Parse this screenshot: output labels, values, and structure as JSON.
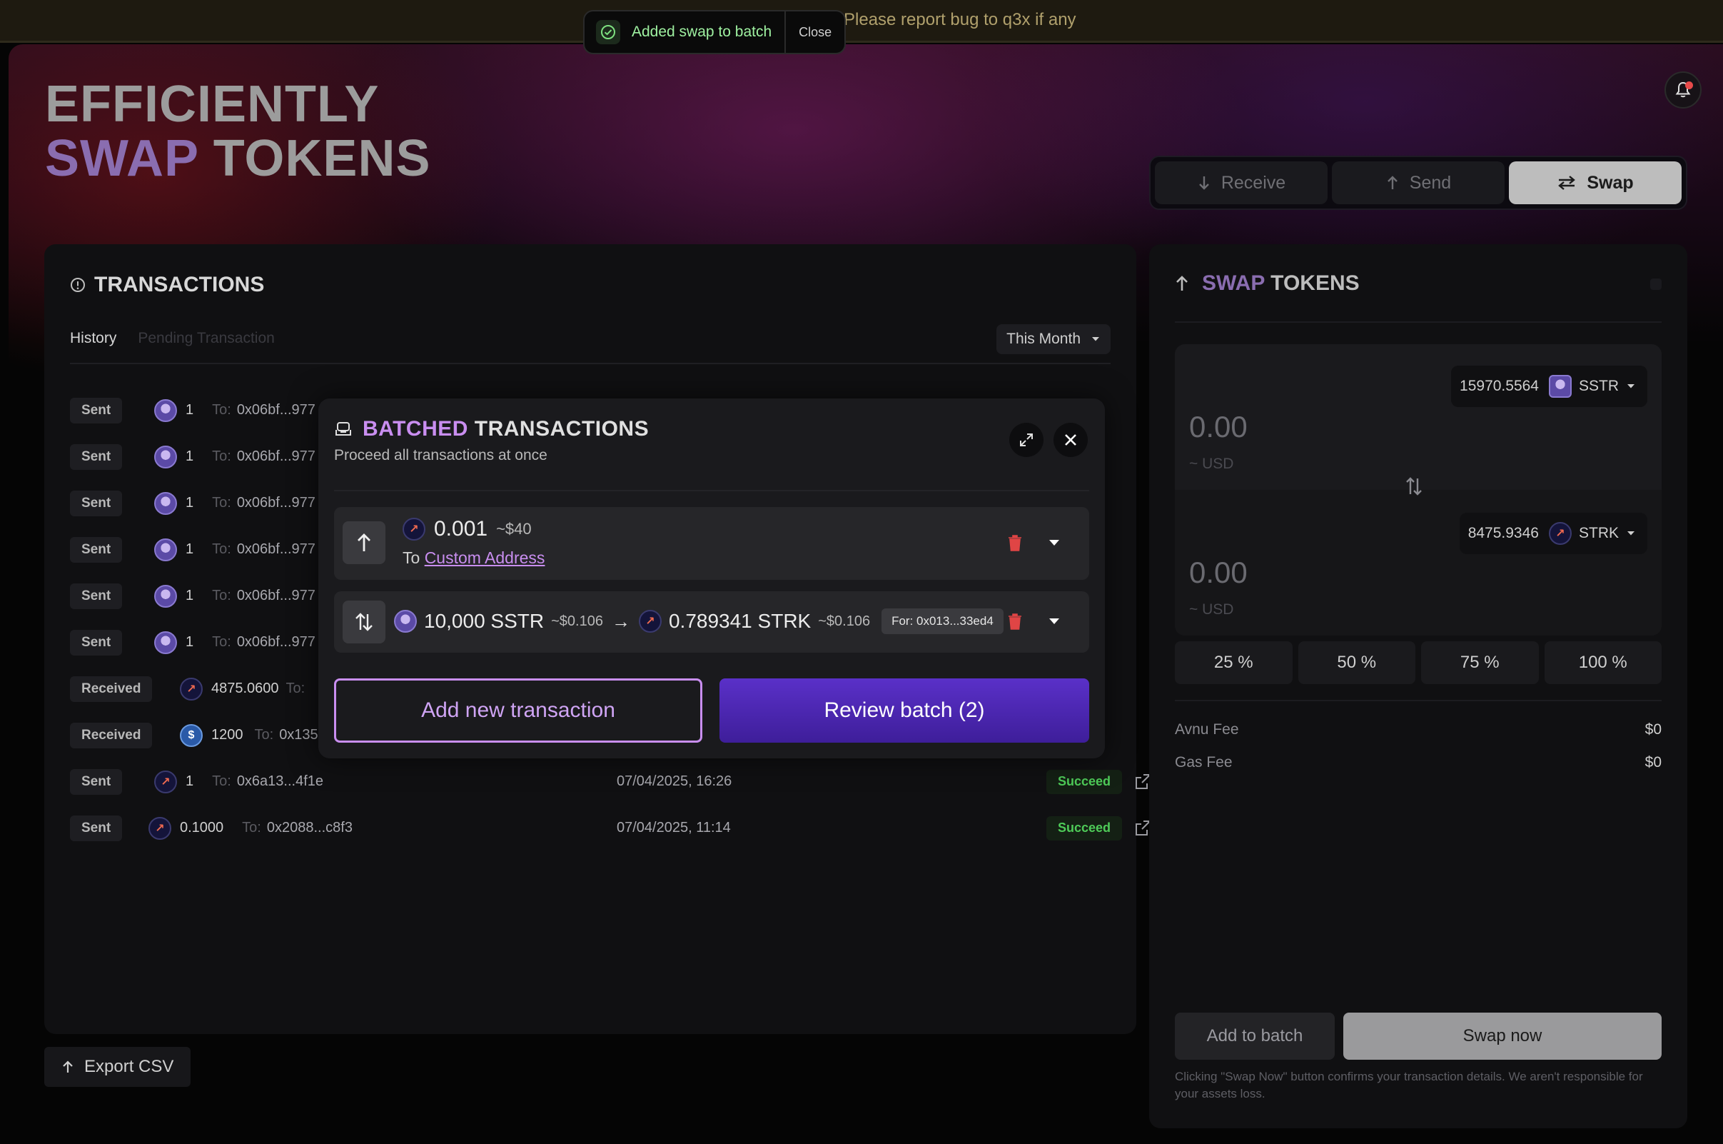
{
  "banner": {
    "text": "Please report bug to q3x if any"
  },
  "toast": {
    "message": "Added swap to batch",
    "close_label": "Close"
  },
  "hero": {
    "title_line1": "EFFICIENTLY",
    "title_line2_a": "SWAP",
    "title_line2_b": "TOKENS"
  },
  "actions": {
    "tabs": [
      {
        "label": "Receive",
        "icon": "arrow-down-icon"
      },
      {
        "label": "Send",
        "icon": "arrow-up-icon"
      },
      {
        "label": "Swap",
        "icon": "swap-icon",
        "active": true
      }
    ]
  },
  "transactions": {
    "title": "TRANSACTIONS",
    "tabs": [
      "History",
      "Pending Transaction"
    ],
    "filter": "This Month",
    "rows": [
      {
        "type": "Sent",
        "token": "sstr",
        "amount": "1",
        "to_label": "To:",
        "to": "0x06bf...977",
        "date": "",
        "status": ""
      },
      {
        "type": "Sent",
        "token": "sstr",
        "amount": "1",
        "to_label": "To:",
        "to": "0x06bf...977",
        "date": "",
        "status": ""
      },
      {
        "type": "Sent",
        "token": "sstr",
        "amount": "1",
        "to_label": "To:",
        "to": "0x06bf...977",
        "date": "",
        "status": ""
      },
      {
        "type": "Sent",
        "token": "sstr",
        "amount": "1",
        "to_label": "To:",
        "to": "0x06bf...977",
        "date": "",
        "status": ""
      },
      {
        "type": "Sent",
        "token": "sstr",
        "amount": "1",
        "to_label": "To:",
        "to": "0x06bf...977",
        "date": "",
        "status": ""
      },
      {
        "type": "Sent",
        "token": "sstr",
        "amount": "1",
        "to_label": "To:",
        "to": "0x06bf...977",
        "date": "",
        "status": ""
      },
      {
        "type": "Received",
        "token": "strk",
        "amount": "4875.0600",
        "to_label": "To:",
        "to": "",
        "date": "",
        "status": ""
      },
      {
        "type": "Received",
        "token": "usdc",
        "amount": "1200",
        "to_label": "To:",
        "to": "0x135",
        "date": "",
        "status": ""
      },
      {
        "type": "Sent",
        "token": "strk",
        "amount": "1",
        "to_label": "To:",
        "to": "0x6a13...4f1e",
        "date": "07/04/2025, 16:26",
        "status": "Succeed"
      },
      {
        "type": "Sent",
        "token": "strk",
        "amount": "0.1000",
        "to_label": "To:",
        "to": "0x2088...c8f3",
        "date": "07/04/2025, 11:14",
        "status": "Succeed"
      }
    ],
    "export_label": "Export CSV"
  },
  "batch_modal": {
    "title_a": "BATCHED",
    "title_b": "TRANSACTIONS",
    "subtitle": "Proceed all transactions at once",
    "send_item": {
      "amount": "0.001",
      "usd": "~$40",
      "to_prefix": "To",
      "to_link": "Custom Address"
    },
    "swap_item": {
      "from_amount": "10,000 SSTR",
      "from_usd": "~$0.106",
      "arrow": "→",
      "to_amount": "0.789341 STRK",
      "to_usd": "~$0.106",
      "for_badge": "For: 0x013...33ed4"
    },
    "add_label": "Add new transaction",
    "review_label": "Review batch (2)"
  },
  "swap": {
    "title_a": "SWAP",
    "title_b": "TOKENS",
    "from": {
      "balance": "15970.5564",
      "token": "SSTR",
      "amount": "0.00",
      "usd": "~ USD"
    },
    "to": {
      "balance": "8475.9346",
      "token": "STRK",
      "amount": "0.00",
      "usd": "~ USD"
    },
    "percents": [
      "25 %",
      "50 %",
      "75 %",
      "100 %"
    ],
    "fees": [
      {
        "label": "Avnu Fee",
        "value": "$0"
      },
      {
        "label": "Gas Fee",
        "value": "$0"
      }
    ],
    "add_batch_label": "Add to batch",
    "swap_now_label": "Swap now",
    "disclaimer": "Clicking \"Swap Now\" button confirms your transaction details. We aren't responsible for your assets loss."
  },
  "colors": {
    "accent_purple": "#c98ef0",
    "review_button": "#5a30c8",
    "success_green": "#4ecb58"
  }
}
